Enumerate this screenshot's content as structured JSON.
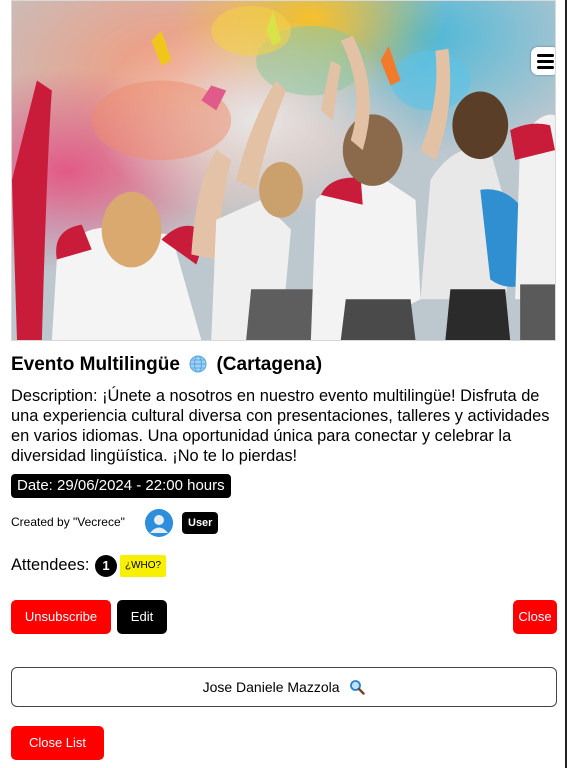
{
  "event": {
    "title": "Evento Multilingüe",
    "city": "(Cartagena)",
    "description": "Description: ¡Únete a nosotros en nuestro evento multilingüe! Disfruta de una experiencia cultural diversa con presentaciones, talleres y actividades en varios idiomas. Una oportunidad única para conectar y celebrar la diversidad lingüística. ¡No te lo pierdas!",
    "date": "Date: 29/06/2024 - 22:00 hours",
    "created_by": "Created by \"Vecrece\"",
    "role_badge": "User",
    "attendees_label": "Attendees:",
    "attendees_count": "1",
    "who_button": "¿WHO?"
  },
  "actions": {
    "unsubscribe": "Unsubscribe",
    "edit": "Edit",
    "close": "Close"
  },
  "attendee_list": {
    "items": [
      "Jose Daniele Mazzola"
    ],
    "close_list": "Close List"
  },
  "icons": {
    "menu": "hamburger-menu-icon",
    "globe": "globe-icon",
    "avatar": "user-avatar-icon",
    "search": "magnifier-icon"
  },
  "colors": {
    "danger": "#ff0000",
    "dark": "#000000",
    "highlight": "#f7f000",
    "avatar": "#2d8fdc"
  }
}
